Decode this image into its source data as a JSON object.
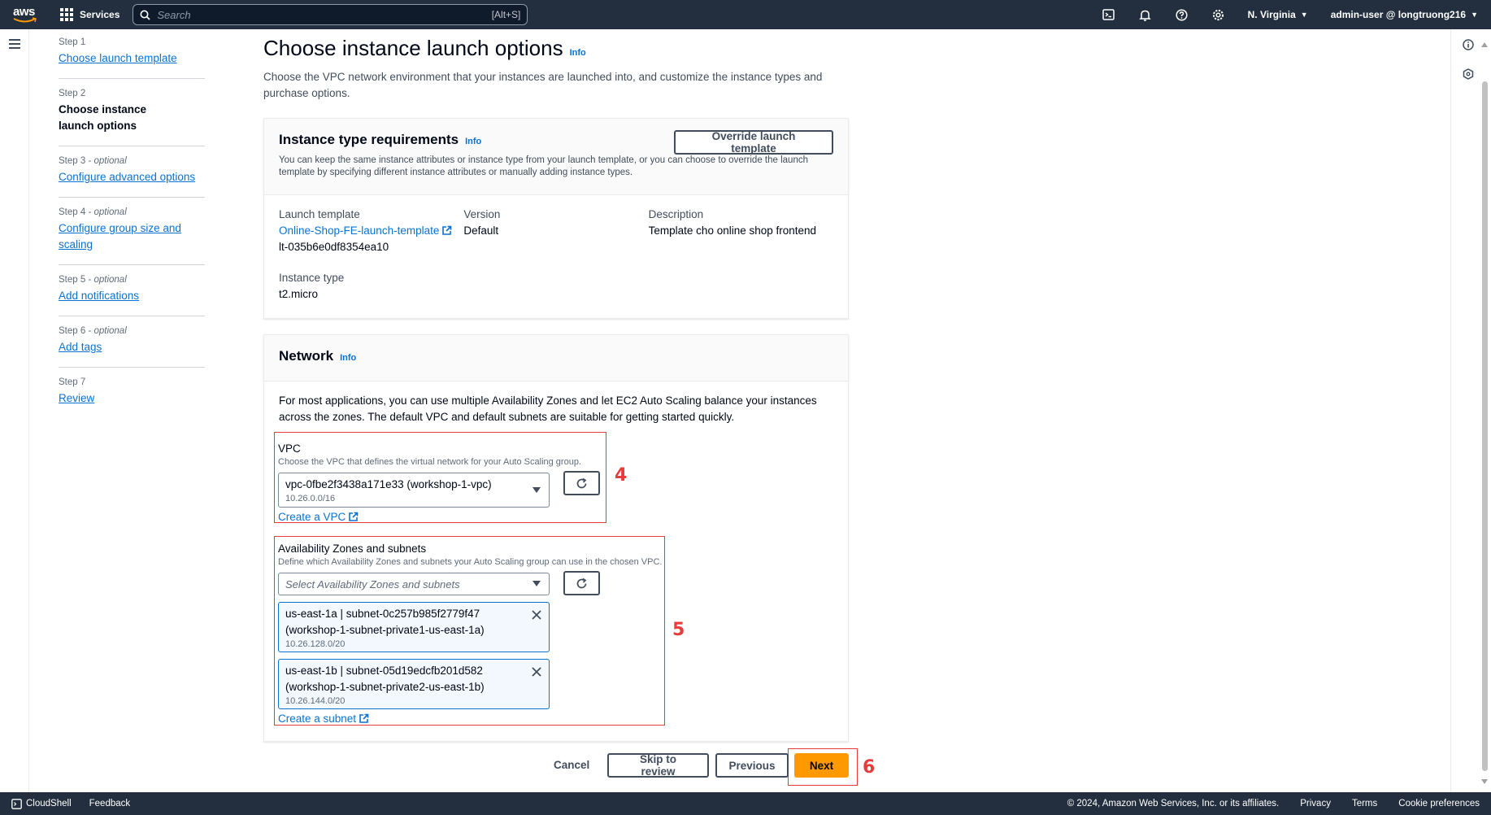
{
  "topnav": {
    "logo_text": "aws",
    "services_label": "Services",
    "search_placeholder": "Search",
    "search_shortcut": "[Alt+S]",
    "region": "N. Virginia",
    "account": "admin-user @ longtruong216"
  },
  "steps": [
    {
      "label": "Step 1",
      "optional": "",
      "title": "Choose launch template",
      "current": false
    },
    {
      "label": "Step 2",
      "optional": "",
      "title": "Choose instance launch options",
      "current": true
    },
    {
      "label": "Step 3 - ",
      "optional": "optional",
      "title": "Configure advanced options",
      "current": false
    },
    {
      "label": "Step 4 - ",
      "optional": "optional",
      "title": "Configure group size and scaling",
      "current": false
    },
    {
      "label": "Step 5 - ",
      "optional": "optional",
      "title": "Add notifications",
      "current": false
    },
    {
      "label": "Step 6 - ",
      "optional": "optional",
      "title": "Add tags",
      "current": false
    },
    {
      "label": "Step 7",
      "optional": "",
      "title": "Review",
      "current": false
    }
  ],
  "page": {
    "title": "Choose instance launch options",
    "info": "Info",
    "description": "Choose the VPC network environment that your instances are launched into, and customize the instance types and purchase options."
  },
  "instance_requirements": {
    "title": "Instance type requirements",
    "info": "Info",
    "override_button": "Override launch template",
    "description": "You can keep the same instance attributes or instance type from your launch template, or you can choose to override the launch template by specifying different instance attributes or manually adding instance types.",
    "launch_template_label": "Launch template",
    "launch_template_name": "Online-Shop-FE-launch-template",
    "launch_template_id": "lt-035b6e0df8354ea10",
    "version_label": "Version",
    "version_value": "Default",
    "description_label": "Description",
    "description_value": "Template cho online shop frontend",
    "instance_type_label": "Instance type",
    "instance_type_value": "t2.micro"
  },
  "network": {
    "title": "Network",
    "info": "Info",
    "description": "For most applications, you can use multiple Availability Zones and let EC2 Auto Scaling balance your instances across the zones. The default VPC and default subnets are suitable for getting started quickly.",
    "vpc_label": "VPC",
    "vpc_desc": "Choose the VPC that defines the virtual network for your Auto Scaling group.",
    "vpc_selected": "vpc-0fbe2f3438a171e33 (workshop-1-vpc)",
    "vpc_cidr": "10.26.0.0/16",
    "create_vpc": "Create a VPC",
    "az_label": "Availability Zones and subnets",
    "az_desc": "Define which Availability Zones and subnets your Auto Scaling group can use in the chosen VPC.",
    "az_placeholder": "Select Availability Zones and subnets",
    "subnets": [
      {
        "line1": "us-east-1a | subnet-0c257b985f2779f47",
        "line2": "(workshop-1-subnet-private1-us-east-1a)",
        "cidr": "10.26.128.0/20"
      },
      {
        "line1": "us-east-1b | subnet-05d19edcfb201d582",
        "line2": "(workshop-1-subnet-private2-us-east-1b)",
        "cidr": "10.26.144.0/20"
      }
    ],
    "create_subnet": "Create a subnet"
  },
  "actions": {
    "cancel": "Cancel",
    "skip": "Skip to review",
    "previous": "Previous",
    "next": "Next"
  },
  "annotations": {
    "vpc_number": "4",
    "az_number": "5",
    "next_number": "6"
  },
  "bottombar": {
    "cloudshell": "CloudShell",
    "feedback": "Feedback",
    "copyright": "© 2024, Amazon Web Services, Inc. or its affiliates.",
    "privacy": "Privacy",
    "terms": "Terms",
    "cookie": "Cookie preferences"
  },
  "colors": {
    "nav_bg": "#232f3e",
    "link": "#0972d3",
    "primary": "#ff9900",
    "annotation": "#e83c3c"
  }
}
